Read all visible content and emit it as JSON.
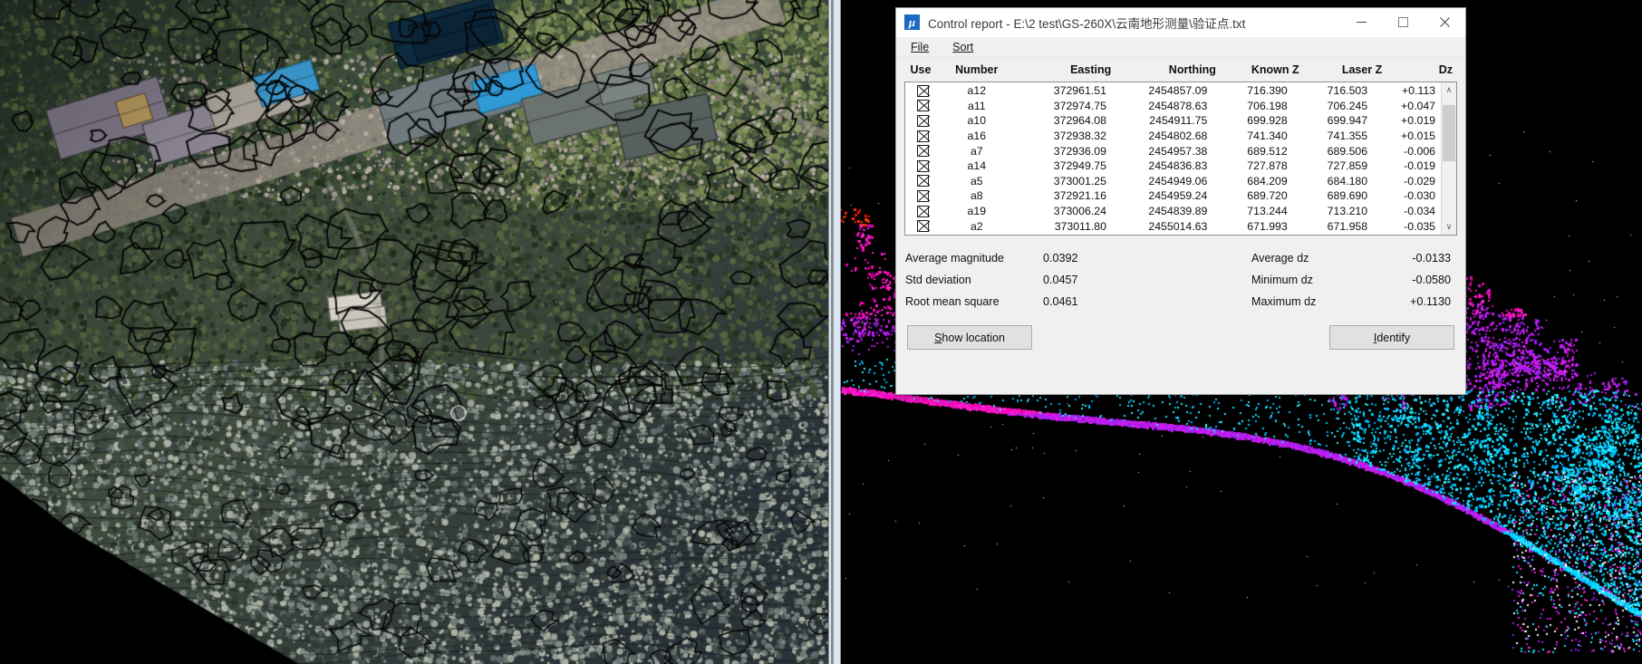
{
  "window": {
    "icon_name": "mu-app-icon",
    "icon_glyph": "μ",
    "title": "Control report - E:\\2 test\\GS-260X\\云南地形测量\\验证点.txt",
    "minimize_label": "—",
    "maximize_label": "☐",
    "close_label": "✕"
  },
  "menu": {
    "items": [
      {
        "label": "File",
        "accel": "F"
      },
      {
        "label": "Sort",
        "accel": "S"
      }
    ]
  },
  "grid": {
    "columns": [
      "Use",
      "Number",
      "Easting",
      "Northing",
      "Known Z",
      "Laser Z",
      "Dz"
    ],
    "rows": [
      {
        "use": true,
        "number": "a12",
        "easting": "372961.51",
        "northing": "2454857.09",
        "known_z": "716.390",
        "laser_z": "716.503",
        "dz": "+0.113"
      },
      {
        "use": true,
        "number": "a11",
        "easting": "372974.75",
        "northing": "2454878.63",
        "known_z": "706.198",
        "laser_z": "706.245",
        "dz": "+0.047"
      },
      {
        "use": true,
        "number": "a10",
        "easting": "372964.08",
        "northing": "2454911.75",
        "known_z": "699.928",
        "laser_z": "699.947",
        "dz": "+0.019"
      },
      {
        "use": true,
        "number": "a16",
        "easting": "372938.32",
        "northing": "2454802.68",
        "known_z": "741.340",
        "laser_z": "741.355",
        "dz": "+0.015"
      },
      {
        "use": true,
        "number": "a7",
        "easting": "372936.09",
        "northing": "2454957.38",
        "known_z": "689.512",
        "laser_z": "689.506",
        "dz": "-0.006"
      },
      {
        "use": true,
        "number": "a14",
        "easting": "372949.75",
        "northing": "2454836.83",
        "known_z": "727.878",
        "laser_z": "727.859",
        "dz": "-0.019"
      },
      {
        "use": true,
        "number": "a5",
        "easting": "373001.25",
        "northing": "2454949.06",
        "known_z": "684.209",
        "laser_z": "684.180",
        "dz": "-0.029"
      },
      {
        "use": true,
        "number": "a8",
        "easting": "372921.16",
        "northing": "2454959.24",
        "known_z": "689.720",
        "laser_z": "689.690",
        "dz": "-0.030"
      },
      {
        "use": true,
        "number": "a19",
        "easting": "373006.24",
        "northing": "2454839.89",
        "known_z": "713.244",
        "laser_z": "713.210",
        "dz": "-0.034"
      },
      {
        "use": true,
        "number": "a2",
        "easting": "373011.80",
        "northing": "2455014.63",
        "known_z": "671.993",
        "laser_z": "671.958",
        "dz": "-0.035"
      }
    ],
    "scrollbar": {
      "up_glyph": "∧",
      "down_glyph": "∨"
    }
  },
  "statistics": [
    {
      "label_left": "Average magnitude",
      "value_left": "0.0392",
      "label_right": "Average dz",
      "value_right": "-0.0133"
    },
    {
      "label_left": "Std deviation",
      "value_left": "0.0457",
      "label_right": "Minimum dz",
      "value_right": "-0.0580"
    },
    {
      "label_left": "Root mean square",
      "value_left": "0.0461",
      "label_right": "Maximum dz",
      "value_right": "+0.1130"
    }
  ],
  "buttons": {
    "show_location": {
      "accel": "S",
      "rest": "how location"
    },
    "identify": {
      "accel": "I",
      "rest": "dentify"
    }
  },
  "colors": {
    "accent": "#1c69c4",
    "dialog_face": "#f0f0f0",
    "titlebar": "#ffffff",
    "grid_bg": "#ffffff",
    "splitter": "#d8e7f5",
    "viewport_bg": "#000000"
  }
}
